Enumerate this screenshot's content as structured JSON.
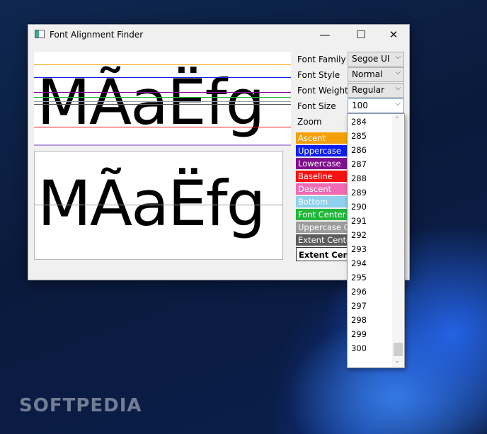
{
  "window": {
    "title": "Font Alignment Finder",
    "minimize": "—",
    "maximize": "☐",
    "close": "✕"
  },
  "preview": {
    "sample_text": "MÃaËfg"
  },
  "props": {
    "font_family": {
      "label": "Font Family",
      "value": "Segoe UI"
    },
    "font_style": {
      "label": "Font Style",
      "value": "Normal"
    },
    "font_weight": {
      "label": "Font Weight",
      "value": "Regular"
    },
    "font_size": {
      "label": "Font Size",
      "value": "100"
    },
    "zoom": {
      "label": "Zoom"
    }
  },
  "legend": [
    {
      "label": "Ascent",
      "color": "#f5a00a"
    },
    {
      "label": "Uppercase",
      "color": "#0a1ef0"
    },
    {
      "label": "Lowercase",
      "color": "#7f0f8f"
    },
    {
      "label": "Baseline",
      "color": "#f51414"
    },
    {
      "label": "Descent",
      "color": "#f06ab4"
    },
    {
      "label": "Bottom",
      "color": "#8fd0ef"
    },
    {
      "label": "Font Center",
      "color": "#22b63a"
    },
    {
      "label": "Uppercase Center",
      "color": "#9c9c9c"
    },
    {
      "label": "Extent Center",
      "color": "#5c5c5c"
    }
  ],
  "legend_boxed": "Extent Center",
  "dropdown": {
    "items": [
      "284",
      "285",
      "286",
      "287",
      "288",
      "289",
      "290",
      "291",
      "292",
      "293",
      "294",
      "295",
      "296",
      "297",
      "298",
      "299",
      "300"
    ]
  },
  "watermark": "SOFTPEDIA"
}
